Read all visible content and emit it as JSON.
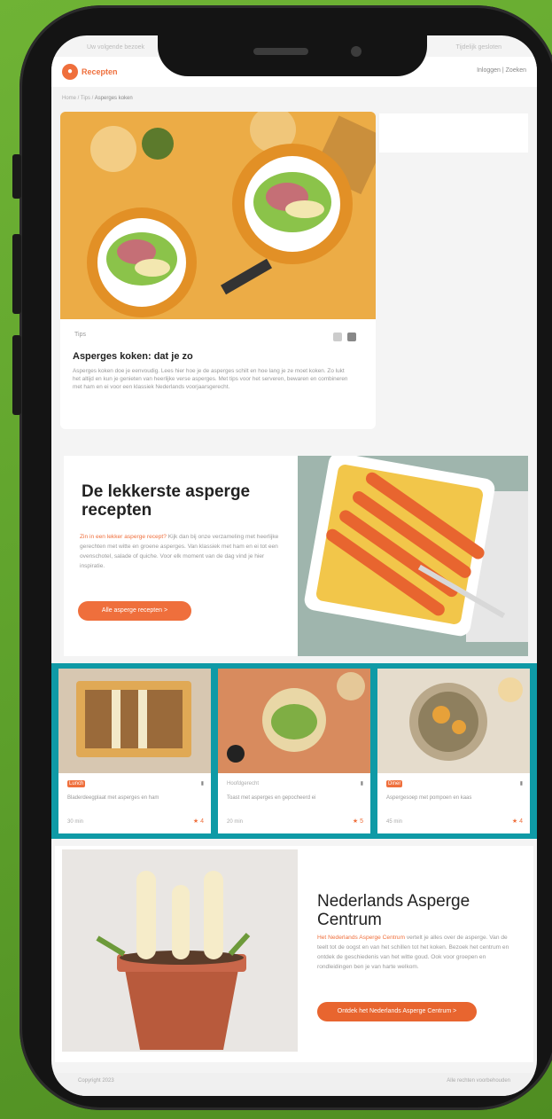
{
  "topbar": {
    "left": "Uw volgende bezoek",
    "right": "Tijdelijk gesloten"
  },
  "header": {
    "logo_text": "Recepten",
    "links": "Inloggen | Zoeken"
  },
  "breadcrumb": {
    "root": "Home / Tips / ",
    "current": "Asperges koken"
  },
  "article": {
    "category": "Tips",
    "title": "Asperges koken: dat je zo",
    "body": "Asperges koken doe je eenvoudig. Lees hier hoe je de asperges schilt en hoe lang je ze moet koken. Zo lukt het altijd en kun je genieten van heerlijke verse asperges. Met tips voor het serveren, bewaren en combineren met ham en ei voor een klassiek Nederlands voorjaarsgerecht."
  },
  "promo": {
    "title": "De lekkerste asperge recepten",
    "body_hl": "Zin in een lekker asperge recept?",
    "body": "Kijk dan bij onze verzameling met heerlijke gerechten met witte en groene asperges. Van klassiek met ham en ei tot een ovenschotel, salade of quiche. Voor elk moment van de dag vind je hier inspiratie.",
    "button": "Alle asperge recepten  >"
  },
  "recipes": [
    {
      "tag": "Lunch",
      "badge": "",
      "desc": "Bladerdeegplaat met asperges en ham",
      "time": "30 min",
      "rating": "4"
    },
    {
      "tag": "",
      "badge": "Hoofdgerecht",
      "desc": "Toast met asperges en gepocheerd ei",
      "time": "20 min",
      "rating": "5"
    },
    {
      "tag": "Diner",
      "badge": "",
      "desc": "Aspergesoep met pompoen en kaas",
      "time": "45 min",
      "rating": "4"
    }
  ],
  "center": {
    "title": "Nederlands Asperge Centrum",
    "body_hl": "Het Nederlands Asperge Centrum",
    "body": "vertelt je alles over de asperge. Van de teelt tot de oogst en van het schillen tot het koken. Bezoek het centrum en ontdek de geschiedenis van het witte goud. Ook voor groepen en rondleidingen ben je van harte welkom.",
    "button": "Ontdek het Nederlands Asperge Centrum  >"
  },
  "footer": {
    "left": "Copyright 2023",
    "right": "Alle rechten voorbehouden"
  },
  "colors": {
    "accent": "#ef6f3c",
    "teal": "#0f9aa6",
    "bg": "#5da02b"
  }
}
